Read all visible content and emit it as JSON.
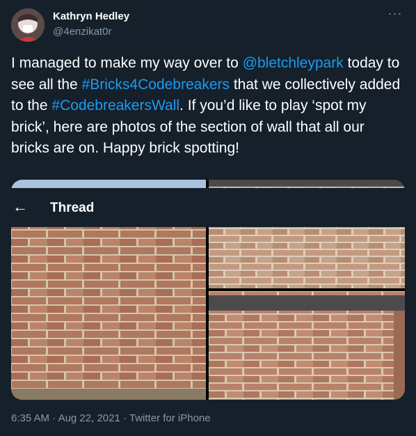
{
  "user": {
    "display_name": "Kathryn Hedley",
    "handle": "@4enzikat0r"
  },
  "menu": {
    "more_glyph": "···"
  },
  "tweet": {
    "segments": [
      {
        "text": "I managed to make my way over to ",
        "link": false
      },
      {
        "text": "@bletchleypark",
        "link": true
      },
      {
        "text": " today to see all the ",
        "link": false
      },
      {
        "text": "#Bricks4Codebreakers",
        "link": true
      },
      {
        "text": " that we collectively added to the ",
        "link": false
      },
      {
        "text": "#CodebreakersWall",
        "link": true
      },
      {
        "text": ". If you’d like to play ‘spot my brick’, here are photos of the section of wall that all our bricks are on. Happy brick spotting!",
        "link": false
      }
    ]
  },
  "thread_bar": {
    "back_glyph": "←",
    "title": "Thread"
  },
  "meta": {
    "time": "6:35 AM",
    "sep1": " · ",
    "date": "Aug 22, 2021",
    "sep2": " · ",
    "source": "Twitter for iPhone"
  },
  "colors": {
    "background": "#15202b",
    "link": "#1d9bf0",
    "secondary_text": "#8b98a5",
    "brick": "#b0785e",
    "mortar": "#d8cbb8"
  },
  "icons": {
    "back": "back-arrow-icon",
    "more": "more-options-icon"
  }
}
